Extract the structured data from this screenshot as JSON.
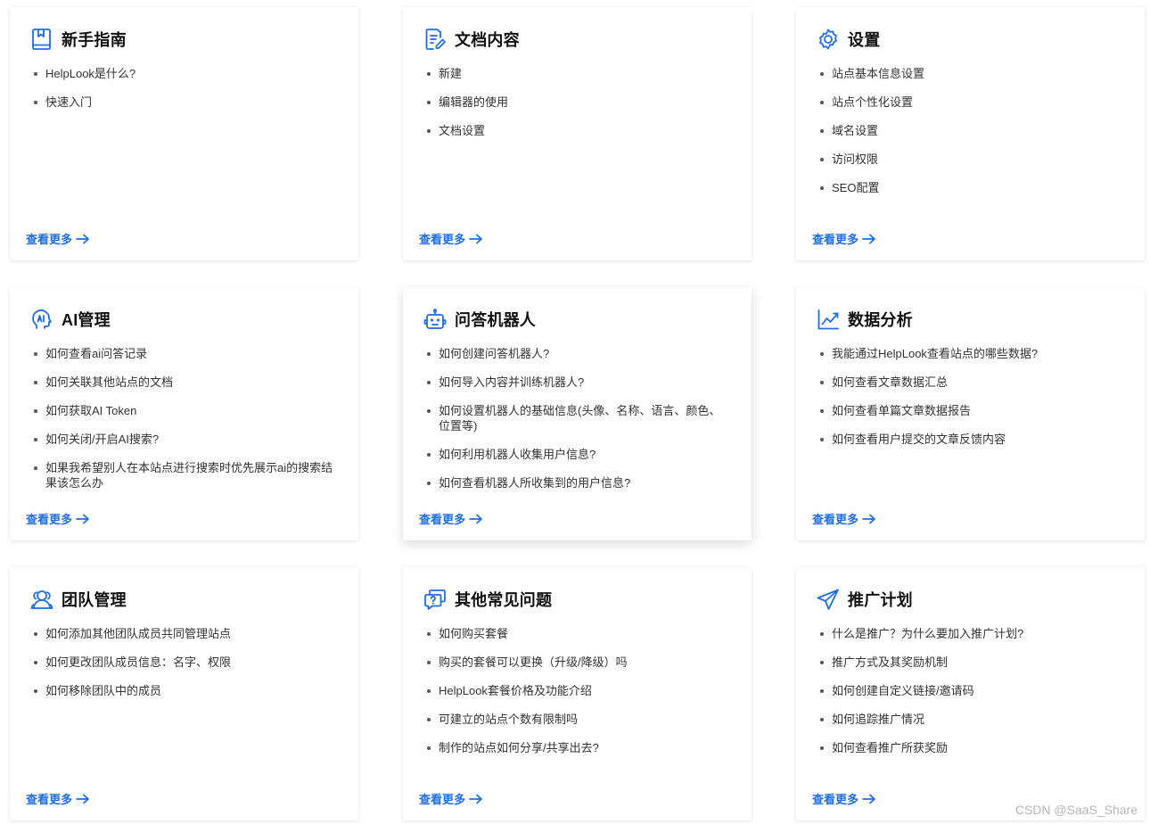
{
  "cards": [
    {
      "title": "新手指南",
      "icon": "book-icon",
      "items": [
        "HelpLook是什么?",
        "快速入门"
      ],
      "more": "查看更多"
    },
    {
      "title": "文档内容",
      "icon": "document-edit-icon",
      "items": [
        "新建",
        "编辑器的使用",
        "文档设置"
      ],
      "more": "查看更多"
    },
    {
      "title": "设置",
      "icon": "gear-icon",
      "items": [
        "站点基本信息设置",
        "站点个性化设置",
        "域名设置",
        "访问权限",
        "SEO配置"
      ],
      "more": "查看更多"
    },
    {
      "title": "AI管理",
      "icon": "ai-head-icon",
      "items": [
        "如何查看ai问答记录",
        "如何关联其他站点的文档",
        "如何获取AI Token",
        "如何关闭/开启AI搜索?",
        "如果我希望别人在本站点进行搜索时优先展示ai的搜索结果该怎么办"
      ],
      "more": "查看更多"
    },
    {
      "title": "问答机器人",
      "icon": "robot-icon",
      "items": [
        "如何创建问答机器人?",
        "如何导入内容并训练机器人?",
        "如何设置机器人的基础信息(头像、名称、语言、颜色、位置等)",
        "如何利用机器人收集用户信息?",
        "如何查看机器人所收集到的用户信息?"
      ],
      "more": "查看更多"
    },
    {
      "title": "数据分析",
      "icon": "chart-trend-icon",
      "items": [
        "我能通过HelpLook查看站点的哪些数据?",
        "如何查看文章数据汇总",
        "如何查看单篇文章数据报告",
        "如何查看用户提交的文章反馈内容"
      ],
      "more": "查看更多"
    },
    {
      "title": "团队管理",
      "icon": "team-icon",
      "items": [
        "如何添加其他团队成员共同管理站点",
        "如何更改团队成员信息：名字、权限",
        "如何移除团队中的成员"
      ],
      "more": "查看更多"
    },
    {
      "title": "其他常见问题",
      "icon": "question-chat-icon",
      "items": [
        "如何购买套餐",
        "购买的套餐可以更换（升级/降级）吗",
        "HelpLook套餐价格及功能介绍",
        "可建立的站点个数有限制吗",
        "制作的站点如何分享/共享出去?"
      ],
      "more": "查看更多"
    },
    {
      "title": "推广计划",
      "icon": "paper-plane-icon",
      "items": [
        "什么是推广？为什么要加入推广计划?",
        "推广方式及其奖励机制",
        "如何创建自定义链接/邀请码",
        "如何追踪推广情况",
        "如何查看推广所获奖励"
      ],
      "more": "查看更多"
    }
  ],
  "watermark": "CSDN @SaaS_Share",
  "colors": {
    "accent": "#1f6fe0"
  }
}
